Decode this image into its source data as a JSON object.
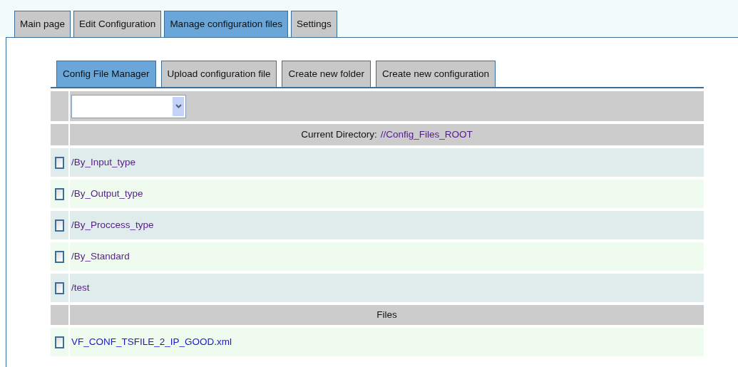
{
  "tabs": [
    {
      "label": "Main page",
      "selected": false
    },
    {
      "label": "Edit Configuration",
      "selected": false
    },
    {
      "label": "Manage configuration files",
      "selected": true
    },
    {
      "label": "Settings",
      "selected": false
    }
  ],
  "subtabs": [
    {
      "label": "Config File Manager",
      "selected": true
    },
    {
      "label": "Upload configuration file",
      "selected": false
    },
    {
      "label": "Create new folder",
      "selected": false
    },
    {
      "label": "Create new configuration",
      "selected": false
    }
  ],
  "current_directory": {
    "label": "Current Directory:",
    "path": "//Config_Files_ROOT",
    "visited": true
  },
  "folders": [
    {
      "name": "/By_Input_type",
      "checked": false,
      "visited": true
    },
    {
      "name": "/By_Output_type",
      "checked": false,
      "visited": true
    },
    {
      "name": "/By_Proccess_type",
      "checked": false,
      "visited": true
    },
    {
      "name": "/By_Standard",
      "checked": false,
      "visited": true
    },
    {
      "name": "/test",
      "checked": false,
      "visited": true
    }
  ],
  "files_header": "Files",
  "files": [
    {
      "name": "VF_CONF_TSFILE_2_IP_GOOD.xml",
      "checked": false,
      "visited": false
    }
  ]
}
